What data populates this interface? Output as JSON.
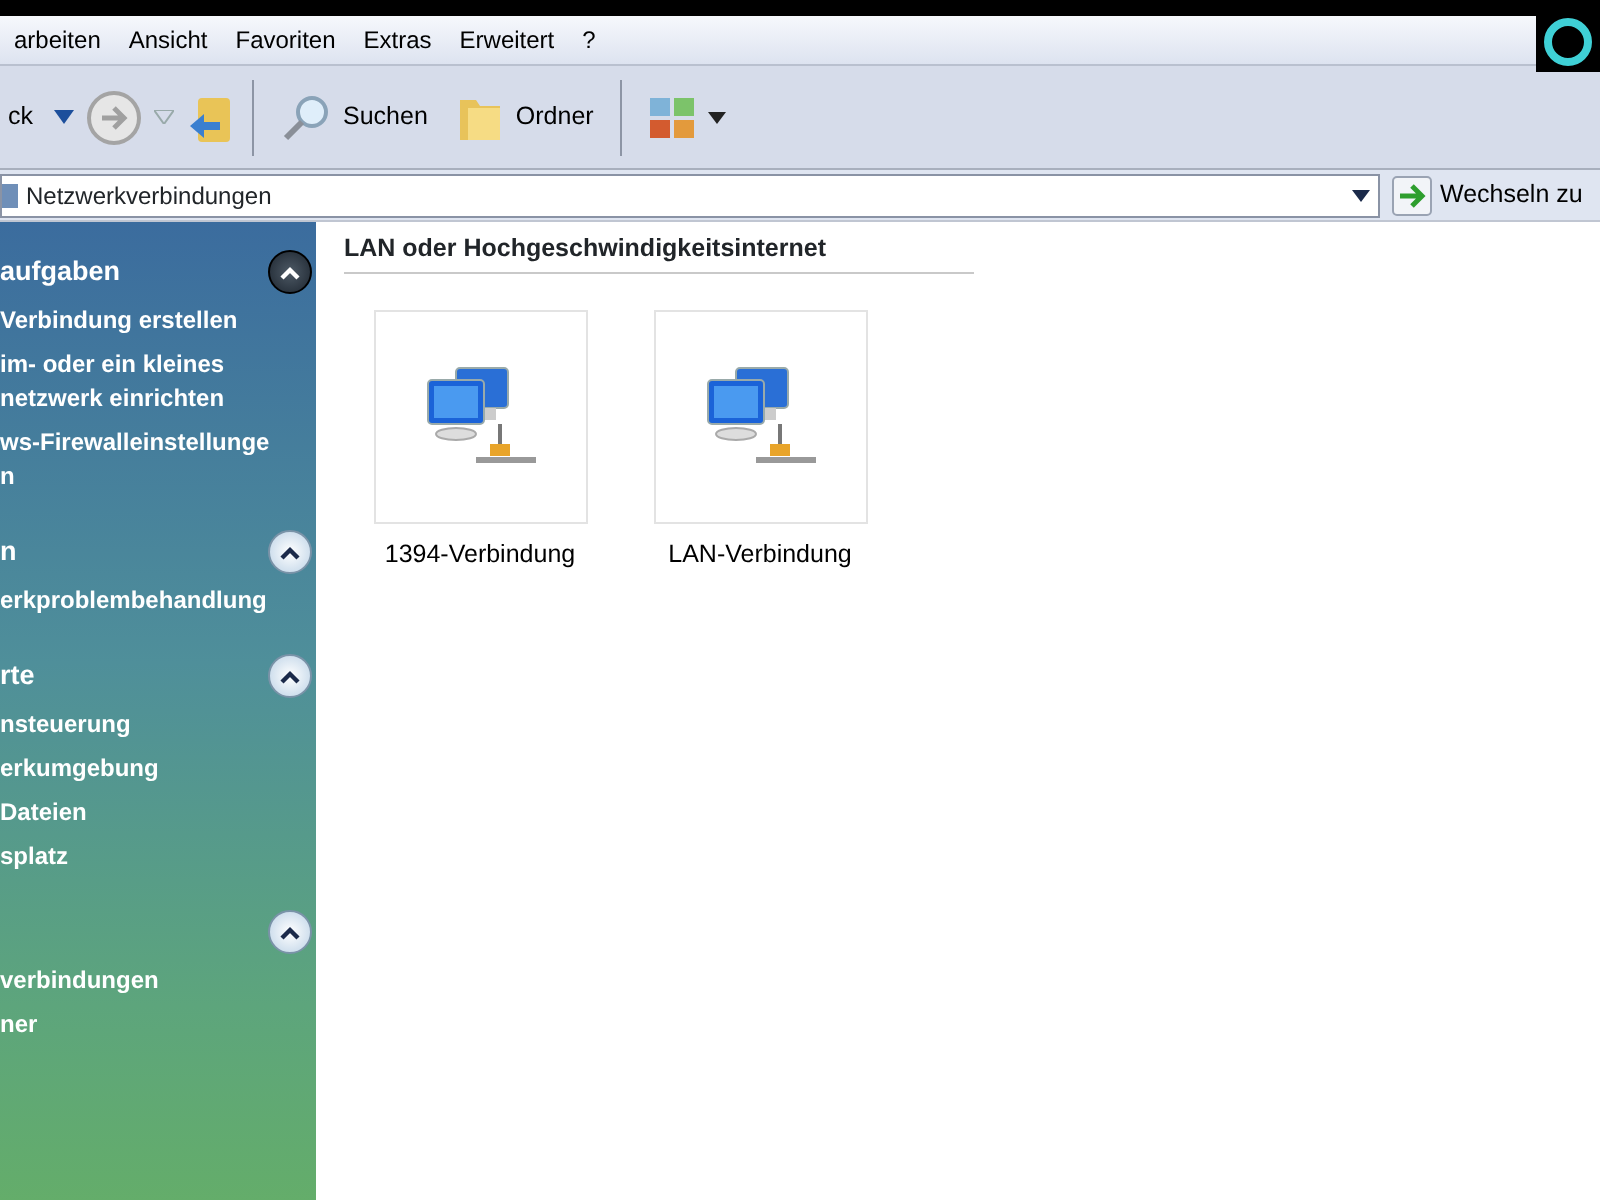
{
  "menu": [
    "arbeiten",
    "Ansicht",
    "Favoriten",
    "Extras",
    "Erweitert",
    "?"
  ],
  "toolbar": {
    "back_label": "ck",
    "search_label": "Suchen",
    "folders_label": "Ordner"
  },
  "address": {
    "value": "Netzwerkverbindungen",
    "go_label": "Wechseln zu"
  },
  "sidebar": [
    {
      "title": "aufgaben",
      "expanded": true,
      "active": true,
      "items": [
        [
          "Verbindung erstellen"
        ],
        [
          "im- oder ein kleines",
          "netzwerk einrichten"
        ],
        [
          "ws-Firewalleinstellunge",
          "n"
        ]
      ]
    },
    {
      "title": "n",
      "expanded": true,
      "active": false,
      "items": [
        [
          "erkproblembehandlung"
        ]
      ]
    },
    {
      "title": "rte",
      "expanded": true,
      "active": false,
      "items": [
        [
          "nsteuerung"
        ],
        [
          "erkumgebung"
        ],
        [
          "Dateien"
        ],
        [
          "splatz"
        ]
      ]
    },
    {
      "expanded": true,
      "active": false,
      "items": [
        [
          "verbindungen"
        ],
        [
          "ner"
        ]
      ]
    }
  ],
  "group": {
    "title": "LAN oder Hochgeschwindigkeitsinternet",
    "items": [
      {
        "label": "1394-Verbindung"
      },
      {
        "label": "LAN-Verbindung"
      }
    ]
  }
}
